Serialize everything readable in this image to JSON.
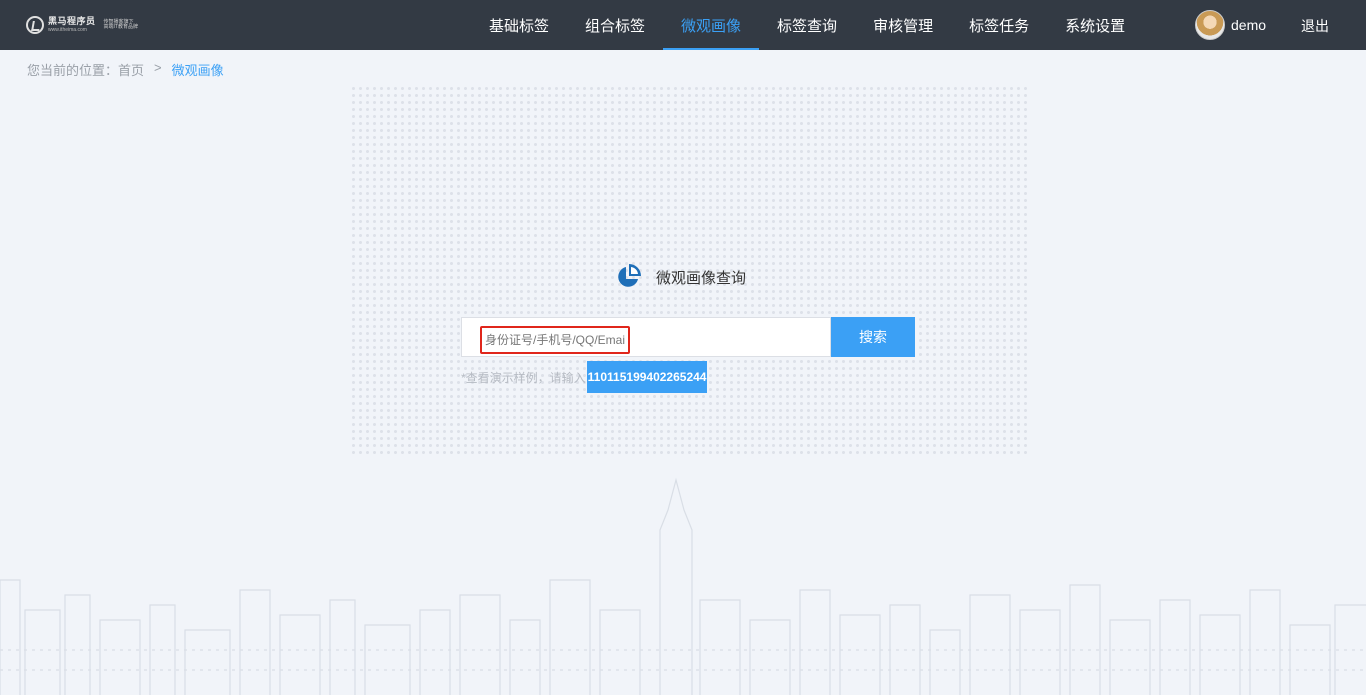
{
  "header": {
    "logo": {
      "brand": "黑马程序员",
      "url": "www.itheima.com",
      "slogan_line1": "传智播客旗下",
      "slogan_line2": "高端IT教育品牌"
    },
    "nav": [
      {
        "label": "基础标签",
        "active": false
      },
      {
        "label": "组合标签",
        "active": false
      },
      {
        "label": "微观画像",
        "active": true
      },
      {
        "label": "标签查询",
        "active": false
      },
      {
        "label": "审核管理",
        "active": false
      },
      {
        "label": "标签任务",
        "active": false
      },
      {
        "label": "系统设置",
        "active": false
      }
    ],
    "user": {
      "name": "demo"
    },
    "logout_label": "退出"
  },
  "breadcrumb": {
    "prefix": "您当前的位置：",
    "home": "首页",
    "separator": ">",
    "current": "微观画像"
  },
  "search": {
    "title": "微观画像查询",
    "placeholder": "身份证号/手机号/QQ/Email",
    "value": "",
    "button_label": "搜索",
    "hint_text": "*查看演示样例，请输入",
    "sample_id": "110115199402265244"
  },
  "colors": {
    "header_bg": "#333a44",
    "accent": "#3ba0f5",
    "page_bg": "#f1f4f9",
    "highlight_border": "#e0261b"
  },
  "icons": {
    "title_icon": "pie-chart-icon"
  }
}
